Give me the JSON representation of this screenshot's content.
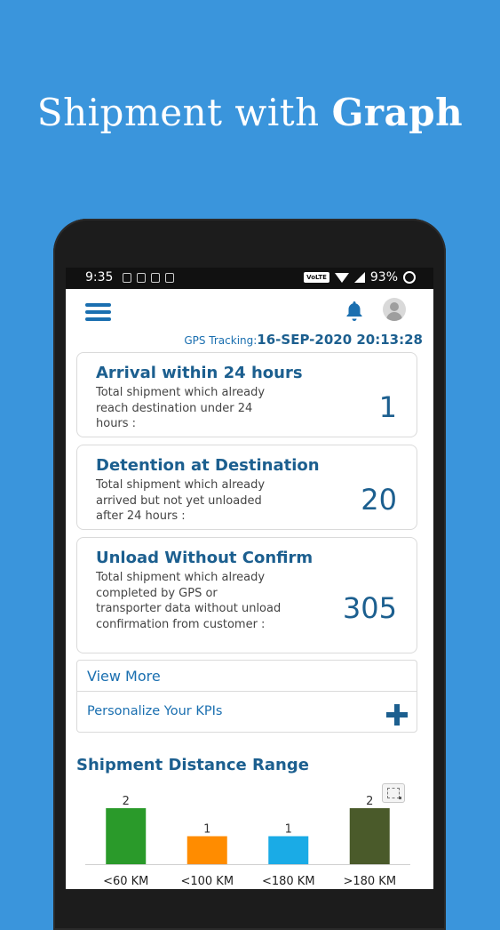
{
  "promo": {
    "title_regular": "Shipment with ",
    "title_bold": "Graph"
  },
  "status_bar": {
    "time": "9:35",
    "network_badge": "VoLTE",
    "battery": "93%"
  },
  "header": {
    "menu_icon": "hamburger-icon",
    "bell_icon": "bell-icon",
    "avatar_icon": "user-avatar-icon"
  },
  "gps": {
    "label": "GPS Tracking:",
    "value": "16-SEP-2020 20:13:28"
  },
  "kpis": [
    {
      "title": "Arrival within 24 hours",
      "description": "Total shipment which already reach destination under 24 hours :",
      "value": "1"
    },
    {
      "title": "Detention at Destination",
      "description": "Total shipment which already arrived but not yet unloaded after 24 hours :",
      "value": "20"
    },
    {
      "title": "Unload Without Confirm",
      "description": "Total shipment which already completed by GPS or transporter data without unload confirmation from customer :",
      "value": "305"
    }
  ],
  "actions": {
    "view_more": "View More",
    "personalize": "Personalize Your KPIs"
  },
  "chart_data": {
    "type": "bar",
    "title": "Shipment Distance Range",
    "categories": [
      "<60 KM",
      "<100 KM",
      "<180 KM",
      ">180 KM"
    ],
    "values": [
      2,
      1,
      1,
      2
    ],
    "colors": [
      "#2a9a2a",
      "#ff8c00",
      "#1aabe6",
      "#4a5a2a"
    ],
    "ylim": [
      0,
      2
    ],
    "grid": false,
    "data_labels": true
  }
}
